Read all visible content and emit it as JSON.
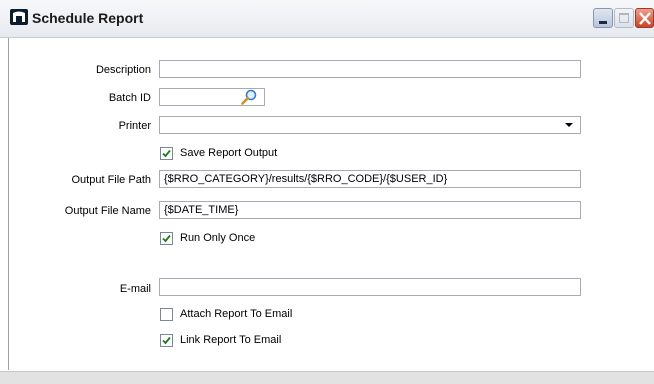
{
  "window": {
    "title": "Schedule Report",
    "controls": {
      "minimize": "minimize",
      "maximize": "maximize",
      "close": "close"
    }
  },
  "form": {
    "description": {
      "label": "Description",
      "value": ""
    },
    "batch_id": {
      "label": "Batch ID",
      "value": ""
    },
    "printer": {
      "label": "Printer",
      "value": ""
    },
    "save_report_output": {
      "label": "Save Report Output",
      "checked": true
    },
    "output_file_path": {
      "label": "Output File Path",
      "value": "{$RRO_CATEGORY}/results/{$RRO_CODE}/{$USER_ID}"
    },
    "output_file_name": {
      "label": "Output File Name",
      "value": "{$DATE_TIME}"
    },
    "run_only_once": {
      "label": "Run Only Once",
      "checked": true
    },
    "email": {
      "label": "E-mail",
      "value": ""
    },
    "attach_report_to_email": {
      "label": "Attach Report To Email",
      "checked": false
    },
    "link_report_to_email": {
      "label": "Link Report To Email",
      "checked": true
    }
  },
  "colors": {
    "check_green": "#1e7a1e",
    "close_button": "#c8452c",
    "title_icon": "#0d1b2e"
  },
  "icons": {
    "title": "report-icon",
    "batch_lookup": "magnifier-icon",
    "dropdown": "chevron-down-icon",
    "check": "checkmark-icon"
  }
}
